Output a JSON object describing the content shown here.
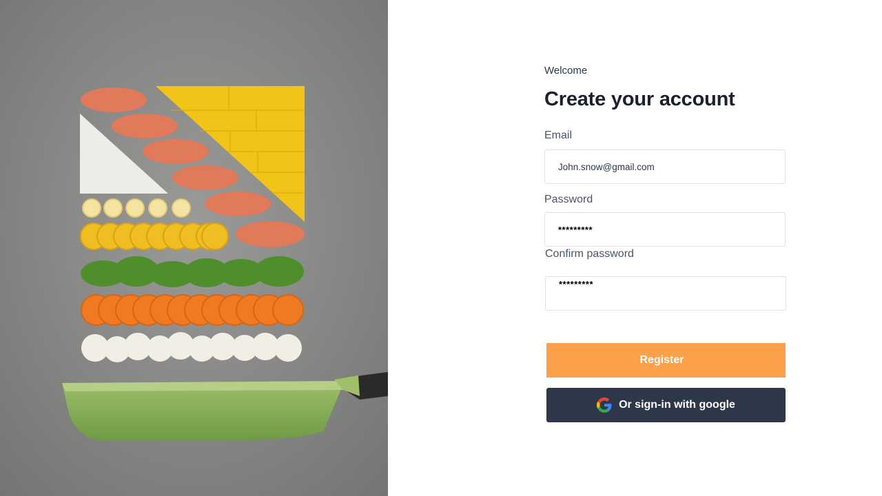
{
  "welcome_text": "Welcome",
  "page_title": "Create your account",
  "form": {
    "email_label": "Email",
    "email_value": "John.snow@gmail.com",
    "password_label": "Password",
    "password_value": "*********",
    "confirm_label": "Confirm password",
    "confirm_value": "*********"
  },
  "buttons": {
    "register_label": "Register",
    "google_label": "Or sign-in with google"
  },
  "icons": {
    "google": "google-logo-icon"
  },
  "colors": {
    "register_bg": "#fe9f4a",
    "google_bg": "#2d3748",
    "title": "#1a202c"
  }
}
